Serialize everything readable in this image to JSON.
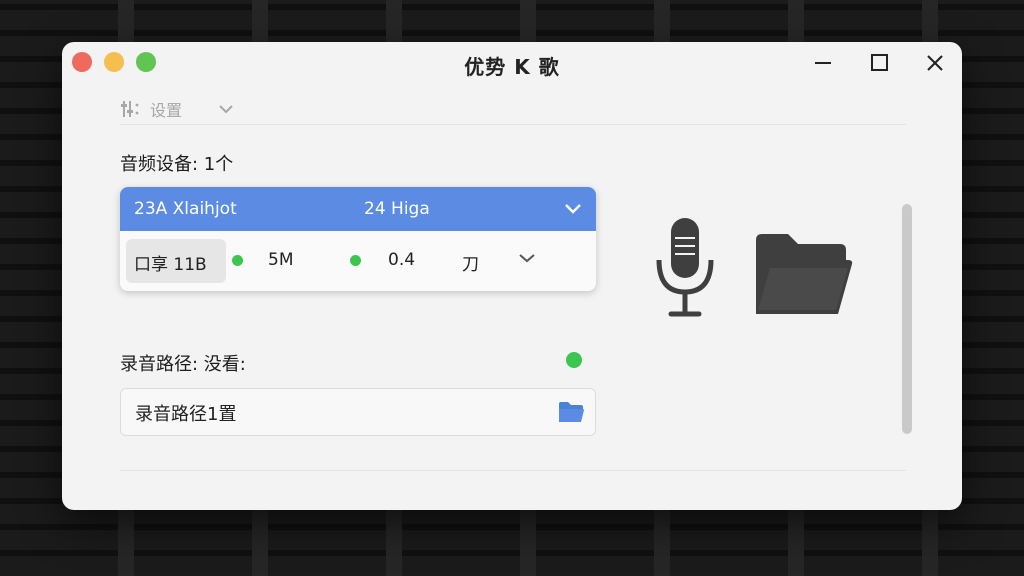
{
  "window": {
    "title": "优势 K 歌"
  },
  "toolbar": {
    "label": "设置"
  },
  "audio_device": {
    "label": "音频设备: 1个",
    "selected": {
      "name": "23A Xlaihjot",
      "detail": "24 Higa"
    },
    "row": {
      "chip_label": "口享 11B",
      "value1": "5M",
      "value2": "0.4",
      "value3": "刀"
    }
  },
  "recording_path": {
    "label": "录音路径: 没看:",
    "value": "录音路径1置",
    "status_color": "#3cc54f"
  },
  "colors": {
    "accent": "#5b8be2",
    "ok": "#3cc54f",
    "icon": "#3f3f3f"
  },
  "icons": {
    "mixer": "sliders-icon",
    "mic": "microphone-icon",
    "folder": "folder-icon"
  }
}
